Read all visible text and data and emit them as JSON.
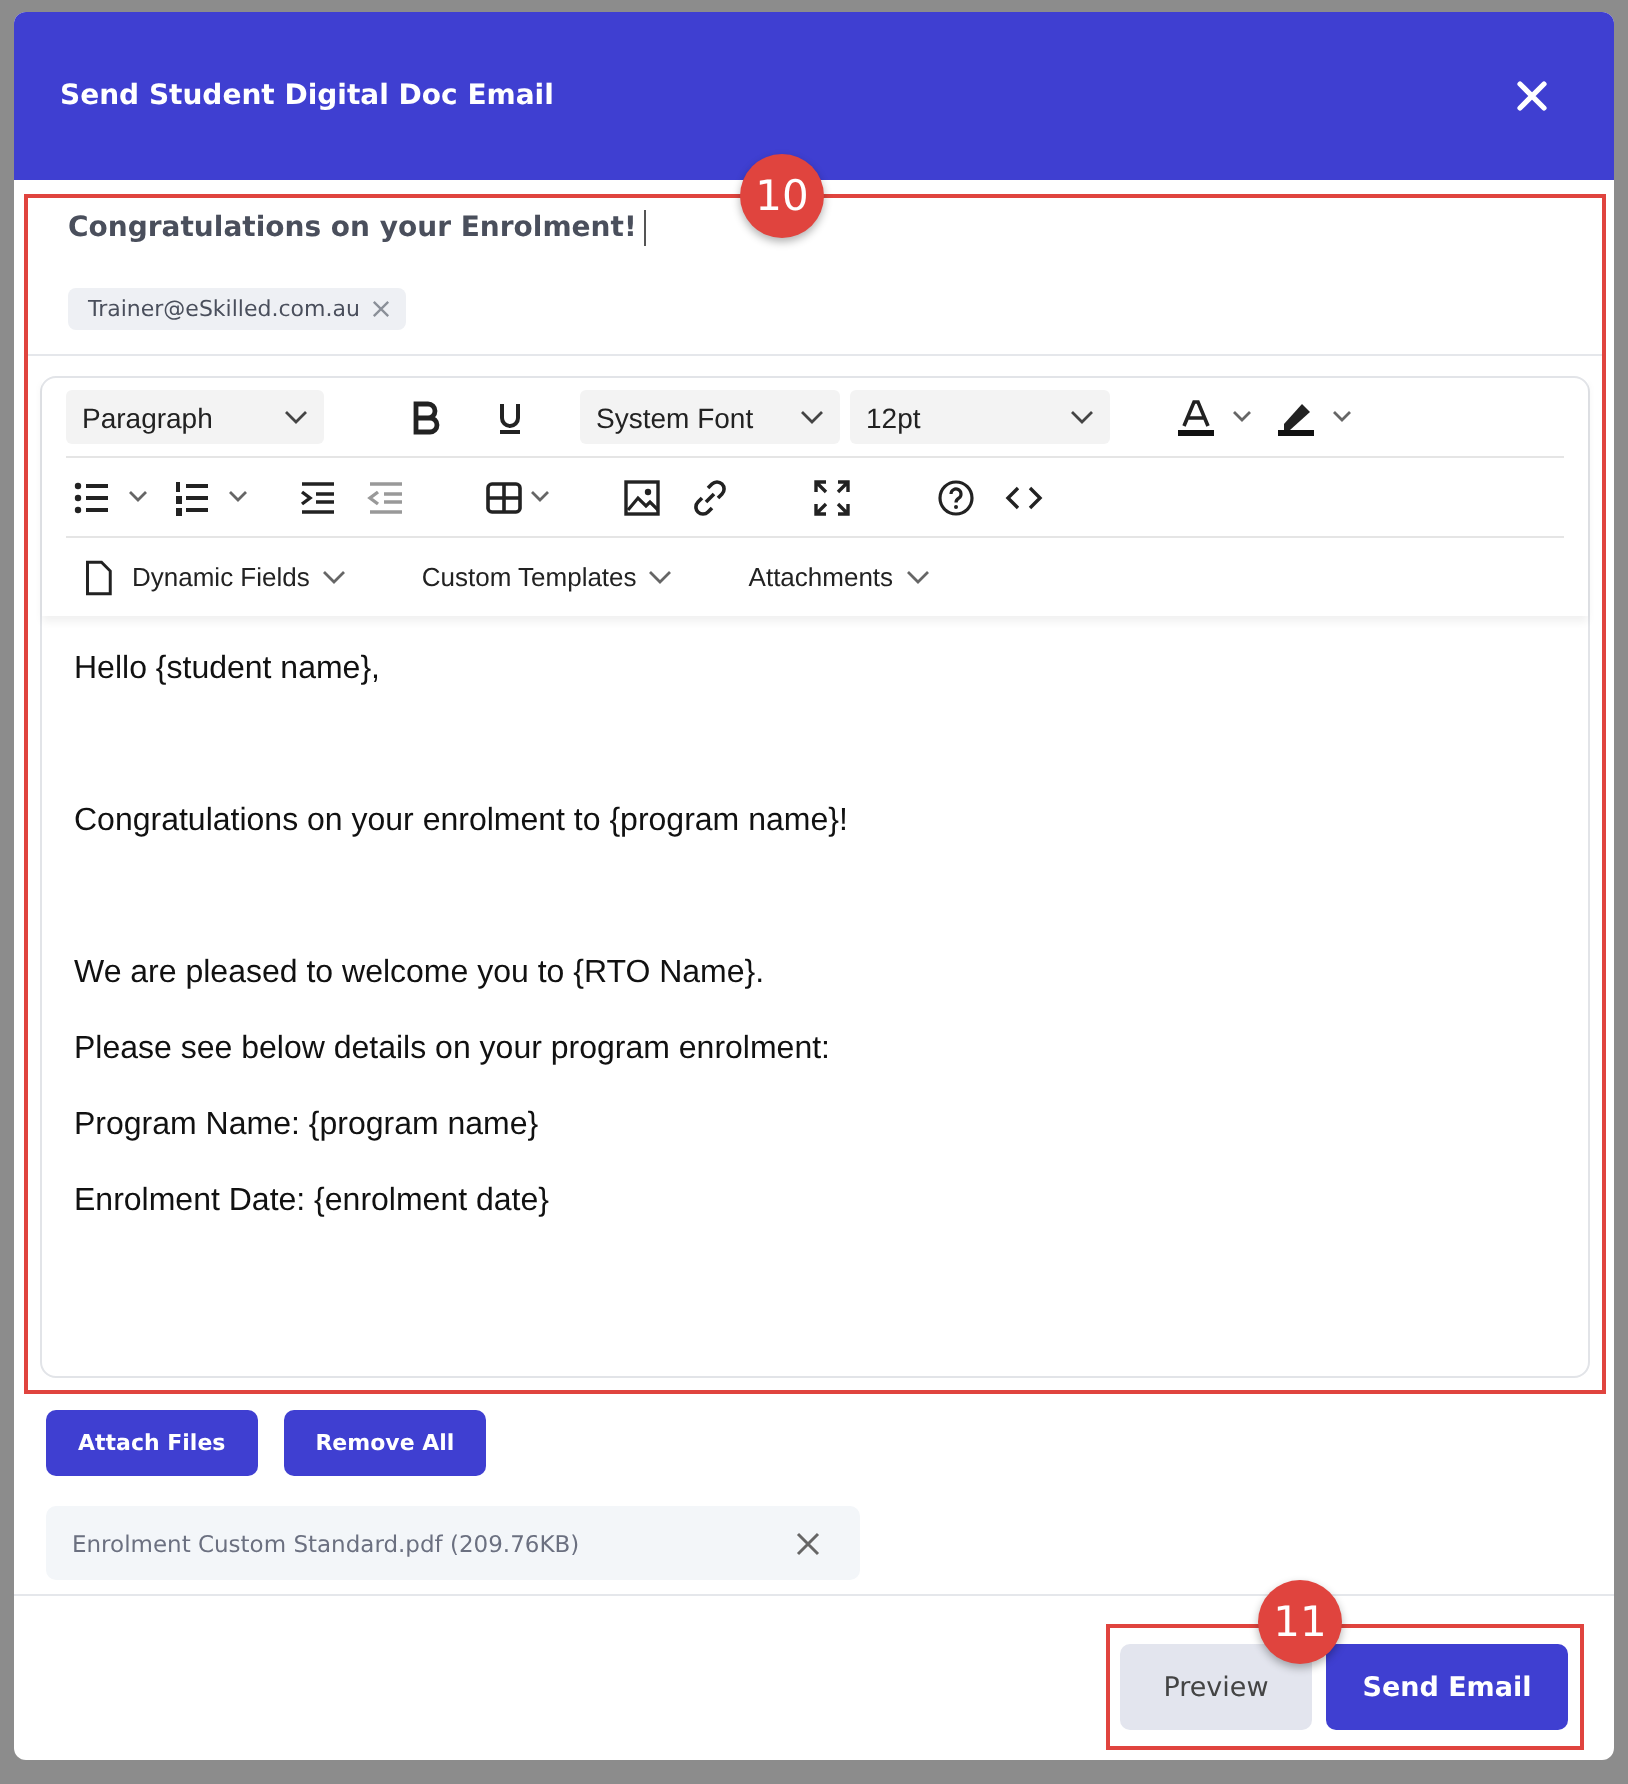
{
  "dialog": {
    "title": "Send Student Digital Doc Email"
  },
  "callouts": [
    {
      "label": "10"
    },
    {
      "label": "11"
    }
  ],
  "subject": "Congratulations on your Enrolment!",
  "recipients": [
    {
      "label": "Trainer@eSkilled.com.au"
    }
  ],
  "toolbar": {
    "block_format": "Paragraph",
    "font": "System Font",
    "size": "12pt",
    "menus": [
      "Dynamic Fields",
      "Custom Templates",
      "Attachments"
    ]
  },
  "body": [
    {
      "text": "Hello {student name},",
      "gap_before": false
    },
    {
      "text": "Congratulations on your enrolment to {program name}!",
      "gap_before": true
    },
    {
      "text": "We are pleased to welcome you to {RTO Name}.",
      "gap_before": true
    },
    {
      "text": "Please see below details on your program enrolment:",
      "gap_before": false
    },
    {
      "text": "Program Name: {program name}",
      "gap_before": false
    },
    {
      "text": "Enrolment Date: {enrolment date}",
      "gap_before": false
    }
  ],
  "attach_buttons": [
    "Attach Files",
    "Remove All"
  ],
  "attachments": [
    {
      "name": "Enrolment Custom Standard.pdf (209.76KB)"
    }
  ],
  "footer_buttons": [
    {
      "label": "Preview",
      "kind": "secondary"
    },
    {
      "label": "Send Email",
      "kind": "primary"
    }
  ]
}
